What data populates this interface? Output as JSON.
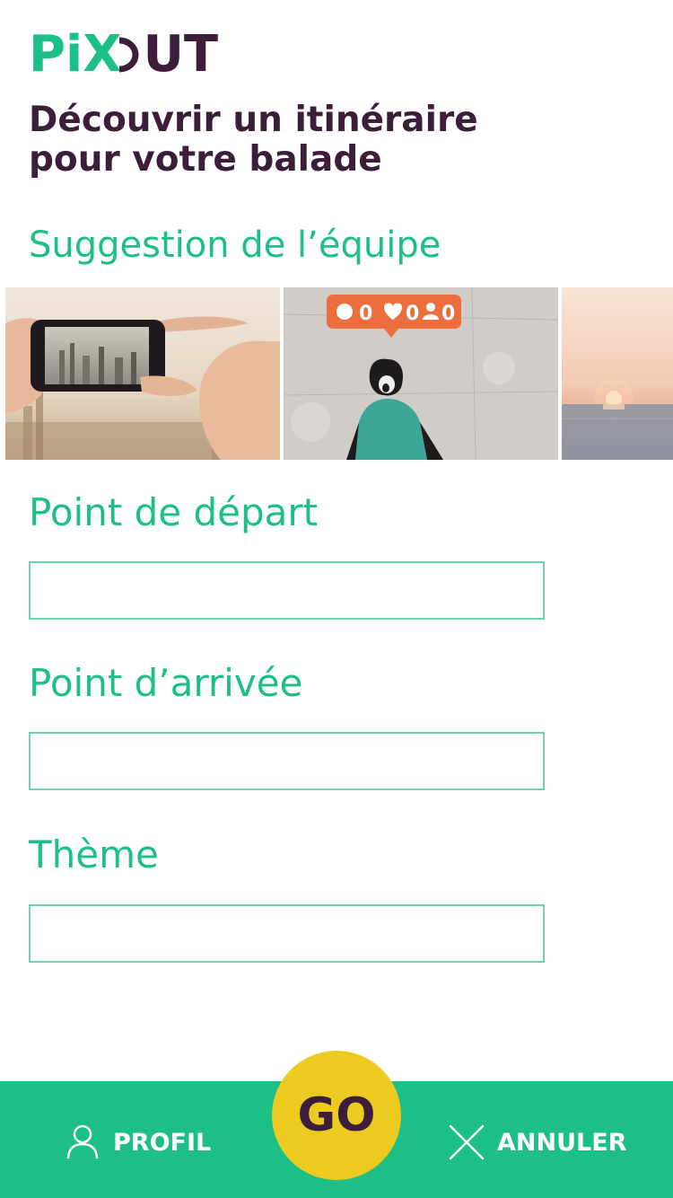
{
  "logo": {
    "part1": "Pi",
    "part2": "X",
    "part3": "UT",
    "alt": "PiXOUT"
  },
  "header": {
    "title_line1": "Découvrir un itinéraire",
    "title_line2": "pour votre balade"
  },
  "suggestions": {
    "heading": "Suggestion de l’équipe",
    "items": [
      {
        "icon": "city-photo-hands-image"
      },
      {
        "icon": "street-art-boy-image"
      },
      {
        "icon": "sunset-sea-image"
      }
    ],
    "street_art_counts": [
      "0",
      "0",
      "0"
    ]
  },
  "form": {
    "start_label": "Point de départ",
    "start_value": "",
    "end_label": "Point d’arrivée",
    "end_value": "",
    "theme_label": "Thème",
    "theme_value": ""
  },
  "nav": {
    "profile_label": "PROFIL",
    "cancel_label": "ANNULER",
    "go_label": "GO"
  },
  "colors": {
    "brand_green": "#1cbf85",
    "brand_purple": "#3c1e3b",
    "go_yellow": "#ecca1f",
    "input_border": "#6fd4ad"
  }
}
